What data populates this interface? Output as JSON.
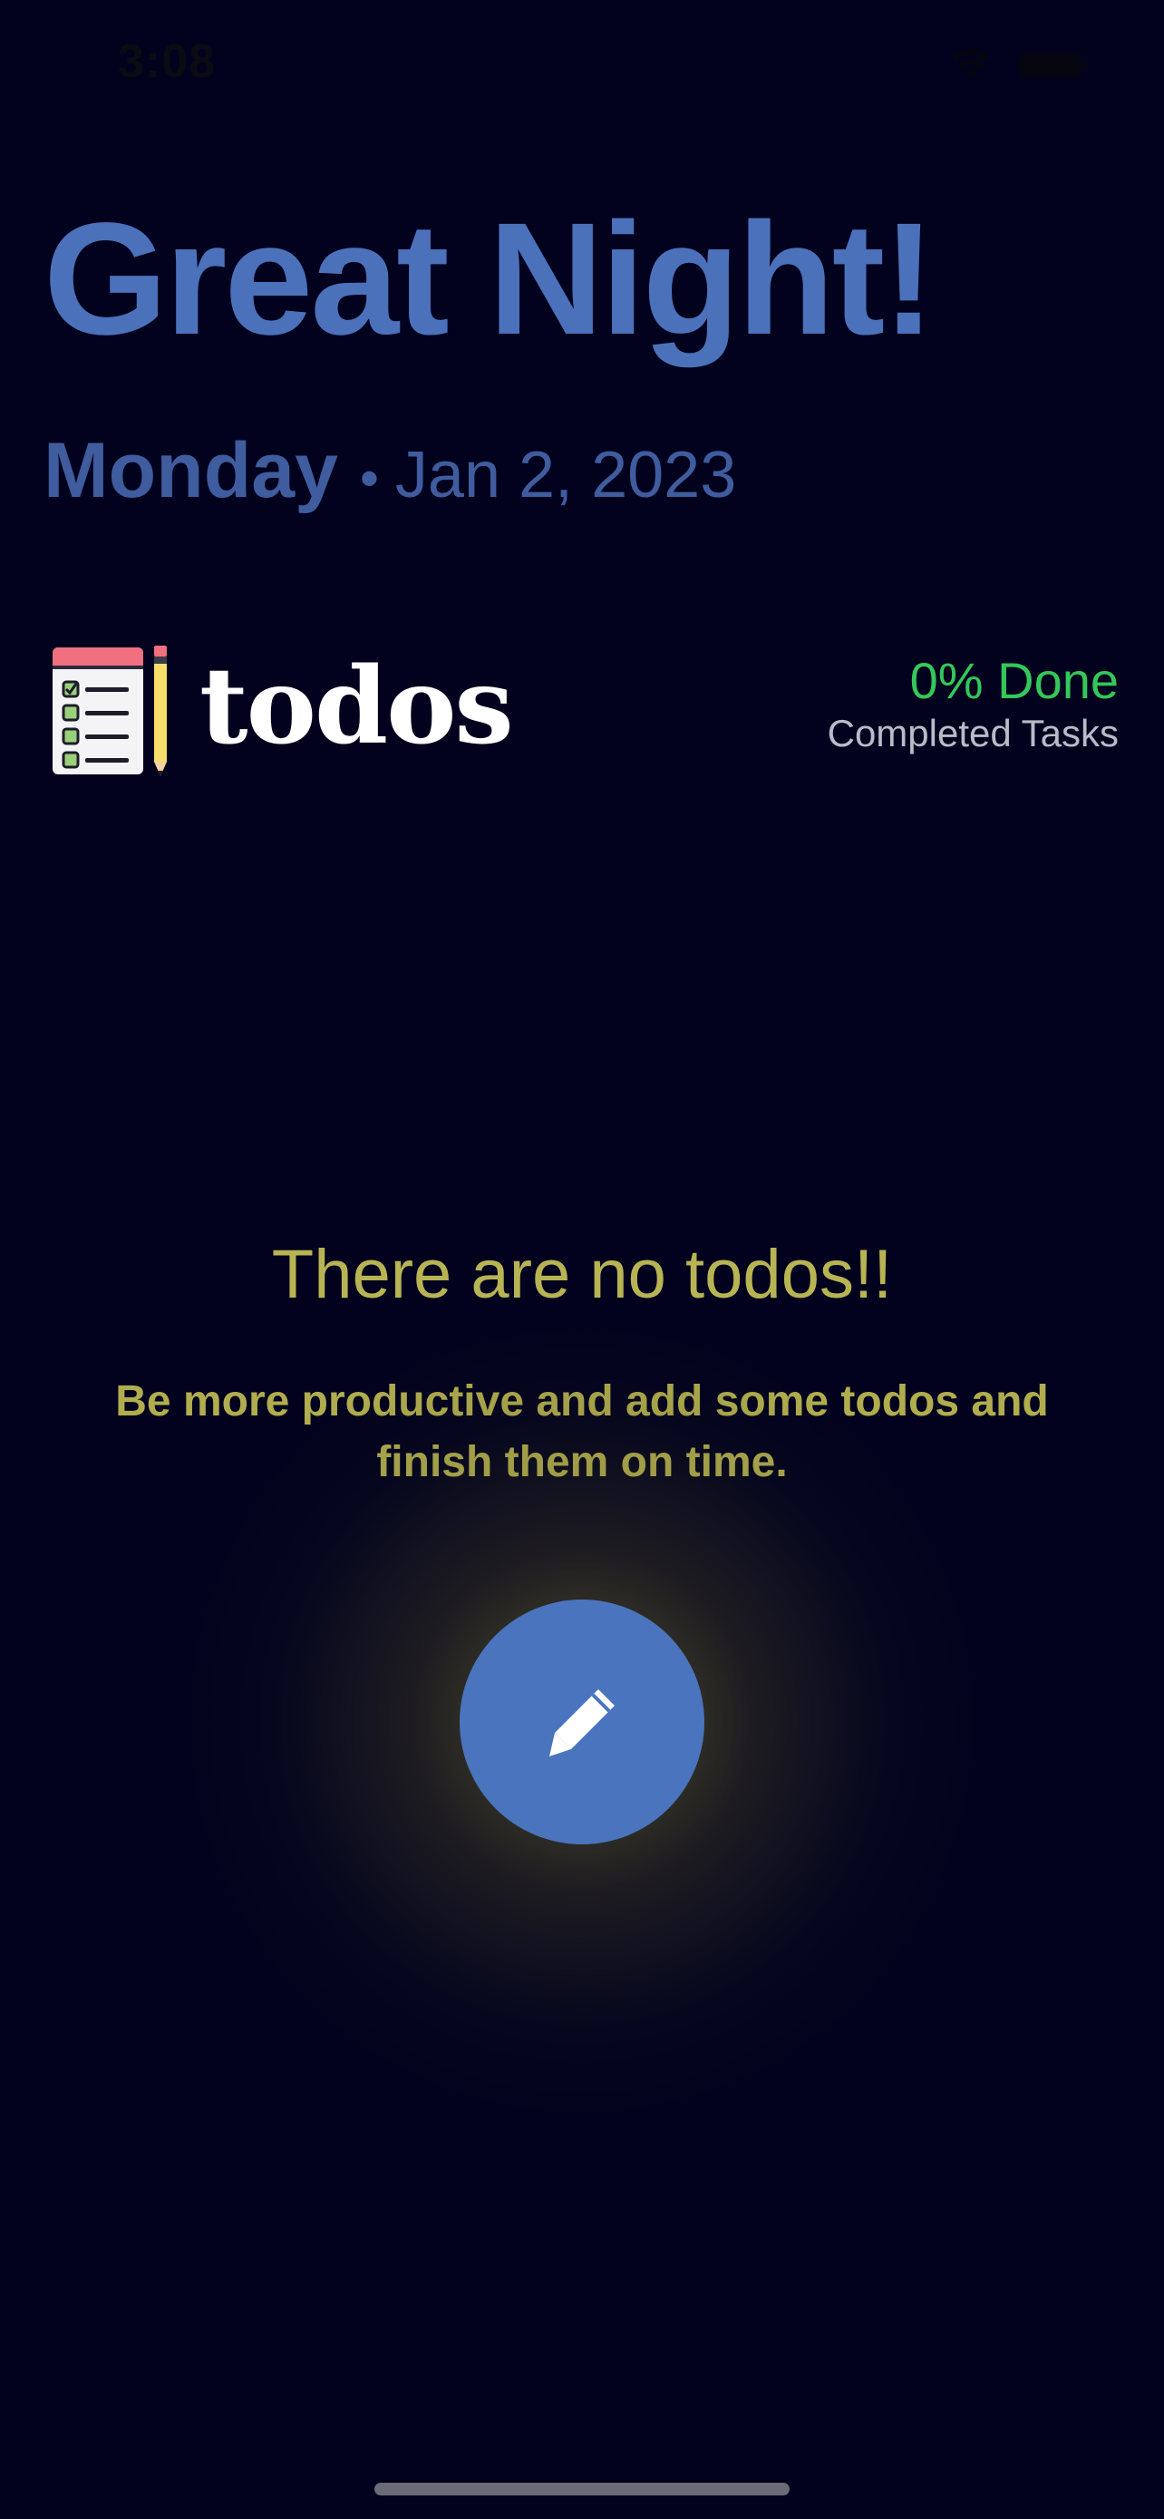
{
  "status_bar": {
    "time": "3:08",
    "wifi_icon": "wifi-icon",
    "battery_icon": "battery-icon"
  },
  "header": {
    "greeting": "Great Night!",
    "day": "Monday",
    "separator": "•",
    "date": "Jan 2, 2023"
  },
  "app": {
    "logo_icon": "checklist-pencil-icon",
    "name": "todos"
  },
  "progress": {
    "value_text": "0% Done",
    "label": "Completed Tasks",
    "percent": 0
  },
  "empty_state": {
    "title": "There are no todos!!",
    "message": "Be more productive and add some todos and finish them on time."
  },
  "fab": {
    "icon": "pencil-icon"
  },
  "colors": {
    "background": "#02021e",
    "accent_blue": "#4a74bd",
    "done_green": "#34c759",
    "empty_yellow": "#b8b454"
  }
}
